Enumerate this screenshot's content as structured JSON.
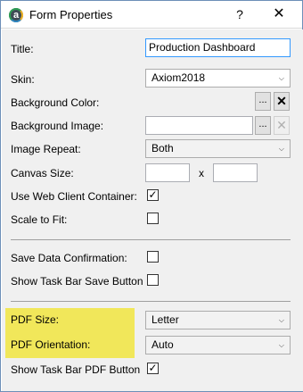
{
  "window": {
    "title": "Form Properties",
    "app_icon_letter": "a",
    "help_label": "?",
    "close_label": "✕"
  },
  "fields": {
    "title_label": "Title:",
    "title_value": "Production Dashboard",
    "skin_label": "Skin:",
    "skin_value": "Axiom2018",
    "bg_color_label": "Background Color:",
    "bg_image_label": "Background Image:",
    "image_repeat_label": "Image Repeat:",
    "image_repeat_value": "Both",
    "canvas_size_label": "Canvas Size:",
    "canvas_size_x": "x",
    "canvas_width": "",
    "canvas_height": "",
    "web_client_label": "Use Web Client Container:",
    "web_client_checked": true,
    "scale_label": "Scale to Fit:",
    "scale_checked": false,
    "save_confirm_label": "Save Data Confirmation:",
    "save_confirm_checked": false,
    "taskbar_save_label": "Show Task Bar Save Button",
    "taskbar_save_checked": false,
    "pdf_size_label": "PDF Size:",
    "pdf_size_value": "Letter",
    "pdf_orientation_label": "PDF Orientation:",
    "pdf_orientation_value": "Auto",
    "taskbar_pdf_label": "Show Task Bar PDF Button",
    "taskbar_pdf_checked": true
  },
  "buttons": {
    "browse_label": "...",
    "clear_label": "✕",
    "check_mark": "✓"
  },
  "colors": {
    "highlight": "#f1e75a",
    "focus_border": "#3399ff"
  },
  "icons": {
    "dropdown": "chevron-down-icon",
    "checkmark": "checkmark-icon"
  }
}
